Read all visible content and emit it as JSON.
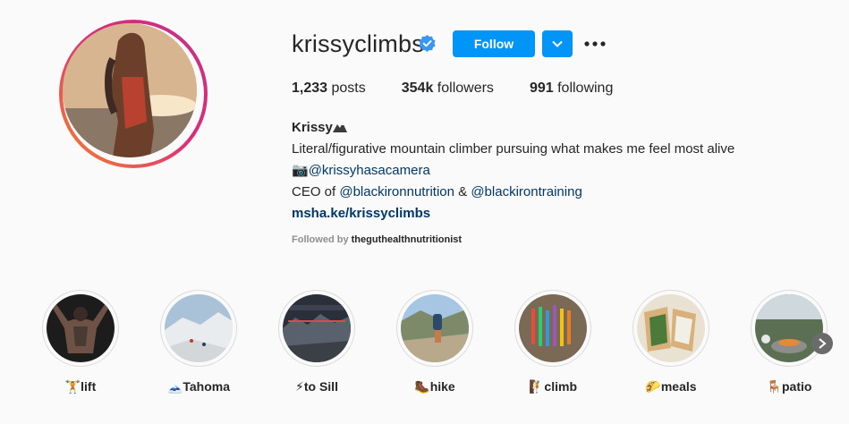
{
  "profile": {
    "username": "krissyclimbs",
    "follow_label": "Follow",
    "stats": {
      "posts_count": "1,233",
      "posts_label": "posts",
      "followers_count": "354k",
      "followers_label": "followers",
      "following_count": "991",
      "following_label": "following"
    },
    "bio": {
      "name": "Krissy",
      "line1": "Literal/figurative mountain climber pursuing what makes me feel most alive",
      "line2_emoji": "📷",
      "line2_mention": "@krissyhasacamera",
      "line3_prefix": "CEO of ",
      "line3_mention1": "@blackironnutrition",
      "line3_amp": " & ",
      "line3_mention2": "@blackirontraining",
      "link": "msha.ke/krissyclimbs"
    },
    "followed_by_label": "Followed by",
    "followed_by_user": "theguthealthnutritionist"
  },
  "colors": {
    "accent_blue": "#0095f6",
    "link_blue": "#00376b",
    "verified_blue": "#3897f0"
  },
  "highlights": [
    {
      "label": "🏋lift"
    },
    {
      "label": "🗻Tahoma"
    },
    {
      "label": "⚡to Sill"
    },
    {
      "label": "🥾hike"
    },
    {
      "label": "🧗climb"
    },
    {
      "label": "🌮meals"
    },
    {
      "label": "🪑patio"
    }
  ]
}
